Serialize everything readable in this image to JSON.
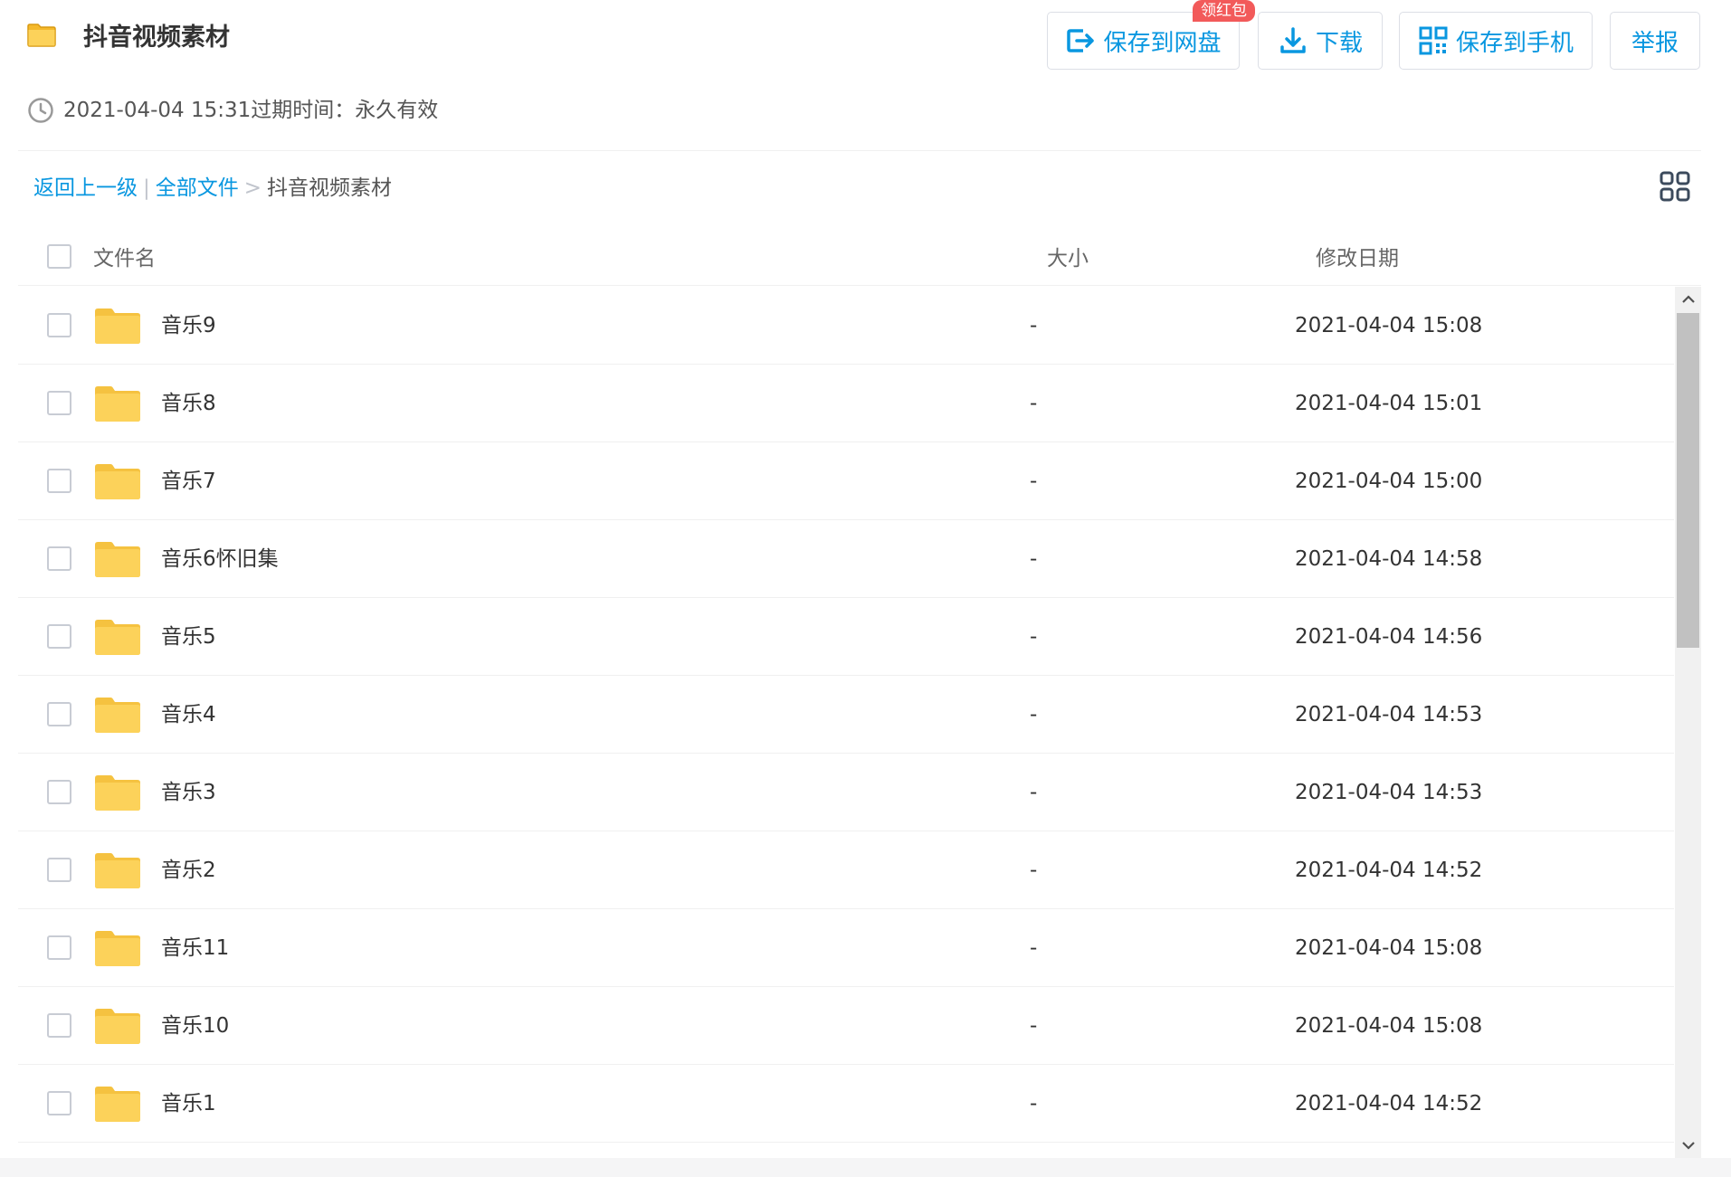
{
  "header": {
    "title": "抖音视频素材",
    "created": "2021-04-04 15:31",
    "expire_label": "过期时间：永久有效",
    "badge": "领红包",
    "buttons": {
      "save_to_disk": "保存到网盘",
      "download": "下载",
      "save_to_phone": "保存到手机",
      "report": "举报"
    }
  },
  "breadcrumb": {
    "back": "返回上一级",
    "all_files": "全部文件",
    "separator": ">",
    "current": "抖音视频素材"
  },
  "table": {
    "columns": {
      "name": "文件名",
      "size": "大小",
      "date": "修改日期"
    },
    "rows": [
      {
        "name": "音乐9",
        "size": "-",
        "date": "2021-04-04 15:08"
      },
      {
        "name": "音乐8",
        "size": "-",
        "date": "2021-04-04 15:01"
      },
      {
        "name": "音乐7",
        "size": "-",
        "date": "2021-04-04 15:00"
      },
      {
        "name": "音乐6怀旧集",
        "size": "-",
        "date": "2021-04-04 14:58"
      },
      {
        "name": "音乐5",
        "size": "-",
        "date": "2021-04-04 14:56"
      },
      {
        "name": "音乐4",
        "size": "-",
        "date": "2021-04-04 14:53"
      },
      {
        "name": "音乐3",
        "size": "-",
        "date": "2021-04-04 14:53"
      },
      {
        "name": "音乐2",
        "size": "-",
        "date": "2021-04-04 14:52"
      },
      {
        "name": "音乐11",
        "size": "-",
        "date": "2021-04-04 15:08"
      },
      {
        "name": "音乐10",
        "size": "-",
        "date": "2021-04-04 15:08"
      },
      {
        "name": "音乐1",
        "size": "-",
        "date": "2021-04-04 14:52"
      }
    ]
  },
  "colors": {
    "accent": "#0997e0",
    "folder": "#fcd25a",
    "badge": "#f25a5a"
  },
  "icons": {
    "title": "folder-icon",
    "meta": "clock-icon",
    "save": "save-to-disk-icon",
    "download": "download-icon",
    "phone": "qr-code-icon",
    "view": "grid-view-icon"
  }
}
